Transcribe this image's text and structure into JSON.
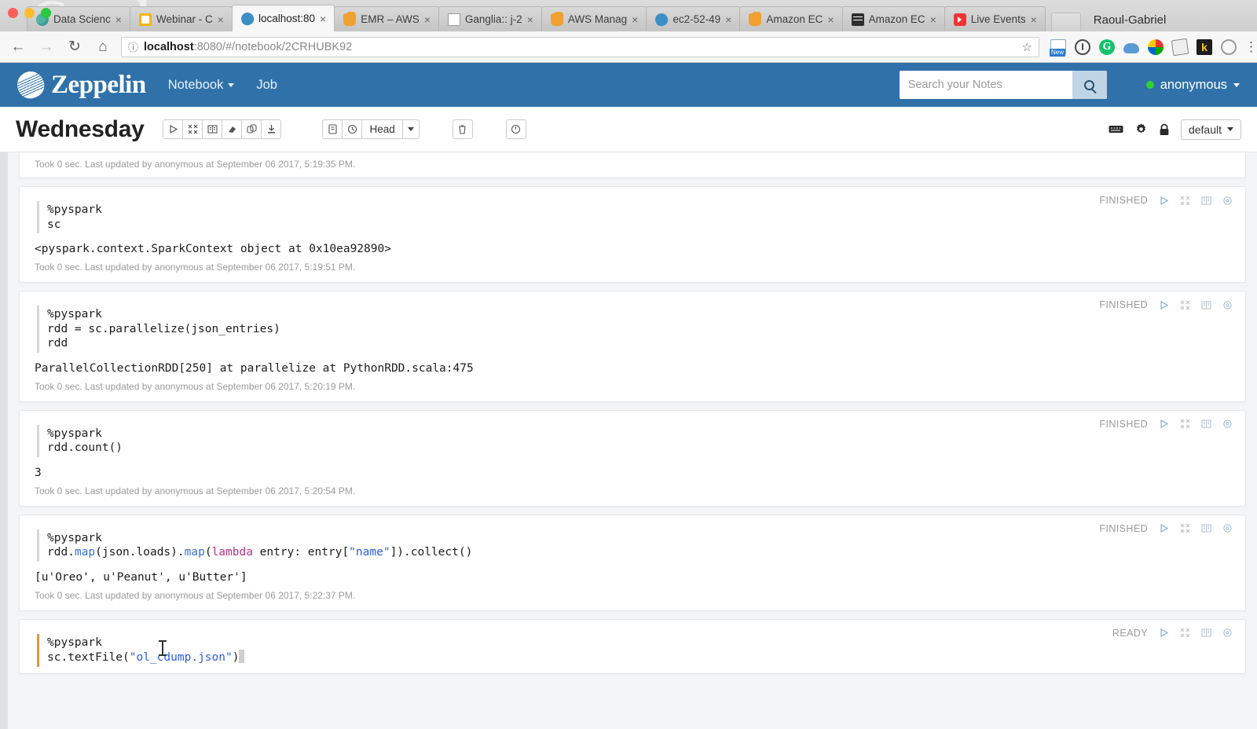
{
  "browser": {
    "profile_name": "Raoul-Gabriel",
    "tabs": [
      {
        "title": "Data Scienc",
        "favicon": "fi-teal",
        "active": false,
        "cut": true
      },
      {
        "title": "Webinar - C",
        "favicon": "fi-yellowsq",
        "active": false,
        "cut": false
      },
      {
        "title": "localhost:80",
        "favicon": "fi-zep",
        "active": true,
        "cut": false
      },
      {
        "title": "EMR – AWS",
        "favicon": "fi-aws",
        "active": false,
        "cut": false
      },
      {
        "title": "Ganglia:: j-2",
        "favicon": "fi-doc",
        "active": false,
        "cut": false
      },
      {
        "title": "AWS Manag",
        "favicon": "fi-aws",
        "active": false,
        "cut": false
      },
      {
        "title": "ec2-52-49",
        "favicon": "fi-zep",
        "active": false,
        "cut": false
      },
      {
        "title": "Amazon EC",
        "favicon": "fi-aws",
        "active": false,
        "cut": false
      },
      {
        "title": "Amazon EC",
        "favicon": "fi-srv",
        "active": false,
        "cut": false
      },
      {
        "title": "Live Events",
        "favicon": "fi-yt",
        "active": false,
        "cut": false
      }
    ],
    "omnibox": {
      "url_host": "localhost",
      "url_rest": ":8080/#/notebook/2CRHUBK92",
      "back_icon": "←",
      "forward_icon": "→",
      "reload_icon": "↻",
      "home_icon": "⌂",
      "info_icon": "ⓘ",
      "star_icon": "☆"
    },
    "extensions": [
      {
        "name": "screenshot-extension-icon",
        "cls": "ext-new",
        "label": ""
      },
      {
        "name": "info-extension-icon",
        "cls": "ext-info",
        "label": ""
      },
      {
        "name": "grammarly-extension-icon",
        "cls": "ext-g",
        "label": "G"
      },
      {
        "name": "cloud-extension-icon",
        "cls": "ext-cloud",
        "label": ""
      },
      {
        "name": "color-ball-extension-icon",
        "cls": "ext-ball",
        "label": ""
      },
      {
        "name": "notes-extension-icon",
        "cls": "ext-env",
        "label": ""
      },
      {
        "name": "kite-extension-icon",
        "cls": "ext-k",
        "label": "k"
      },
      {
        "name": "circle-extension-icon",
        "cls": "ext-circ",
        "label": ""
      }
    ]
  },
  "zeppelin": {
    "brand": "Zeppelin",
    "nav": {
      "notebook": "Notebook",
      "job": "Job"
    },
    "search": {
      "placeholder": "Search your Notes",
      "value": ""
    },
    "user": "anonymous",
    "notebook": {
      "title": "Wednesday",
      "interpreter_binding": "Head",
      "default_label": "default",
      "toolbar_icons": [
        "run-all-paragraphs-icon",
        "collapse-all-icon",
        "show-hide-code-icon",
        "clear-output-icon",
        "clone-note-icon",
        "export-note-icon"
      ],
      "version_icons": [
        "commit-note-icon",
        "revision-history-icon"
      ],
      "right_icons": [
        "keyboard-shortcuts-icon",
        "interpreter-settings-icon",
        "note-permissions-icon"
      ]
    },
    "status_labels": {
      "finished": "FINISHED",
      "ready": "READY"
    },
    "paragraph_icons": [
      "run-paragraph-icon",
      "hide-editor-icon",
      "hide-output-icon",
      "paragraph-settings-icon"
    ],
    "paragraphs": [
      {
        "id": "p0",
        "status": "",
        "code": "",
        "output": "",
        "meta": "Took 0 sec. Last updated by anonymous at September 06 2017, 5:19:35 PM."
      },
      {
        "id": "p1",
        "status": "FINISHED",
        "code_line1": "%pyspark",
        "code_line2": "sc",
        "output": "<pyspark.context.SparkContext object at 0x10ea92890>",
        "meta": "Took 0 sec. Last updated by anonymous at September 06 2017, 5:19:51 PM."
      },
      {
        "id": "p2",
        "status": "FINISHED",
        "code_line1": "%pyspark",
        "code_line2": "rdd = sc.parallelize(json_entries)",
        "code_line3": "rdd",
        "output": "ParallelCollectionRDD[250] at parallelize at PythonRDD.scala:475",
        "meta": "Took 0 sec. Last updated by anonymous at September 06 2017, 5:20:19 PM."
      },
      {
        "id": "p3",
        "status": "FINISHED",
        "code_line1": "%pyspark",
        "code_line2": "rdd.count()",
        "output": "3",
        "meta": "Took 0 sec. Last updated by anonymous at September 06 2017, 5:20:54 PM."
      },
      {
        "id": "p4",
        "status": "FINISHED",
        "code_line1": "%pyspark",
        "code_line2_parts": {
          "a": "rdd.",
          "fn1": "map",
          "b": "(json.loads).",
          "fn2": "map",
          "c": "(",
          "kw": "lambda",
          "d": " entry: entry[",
          "str": "\"name\"",
          "e": "]).collect()"
        },
        "output": "[u'Oreo', u'Peanut', u'Butter']",
        "meta": "Took 0 sec. Last updated by anonymous at September 06 2017, 5:22:37 PM."
      },
      {
        "id": "p5",
        "status": "READY",
        "code_line1": "%pyspark",
        "code_line2_parts": {
          "a": "sc.textFile(",
          "str": "\"ol_cdump.json\"",
          "b": ")"
        },
        "output": "",
        "meta": ""
      }
    ]
  },
  "colors": {
    "zeppelin_blue": "#3071a9",
    "active_cell_border": "#e8943c",
    "status_gray": "#999999",
    "string_blue": "#2b5fd9",
    "function_blue": "#3b6fd4",
    "keyword_magenta": "#b5338c",
    "online_green": "#2fd32f"
  }
}
